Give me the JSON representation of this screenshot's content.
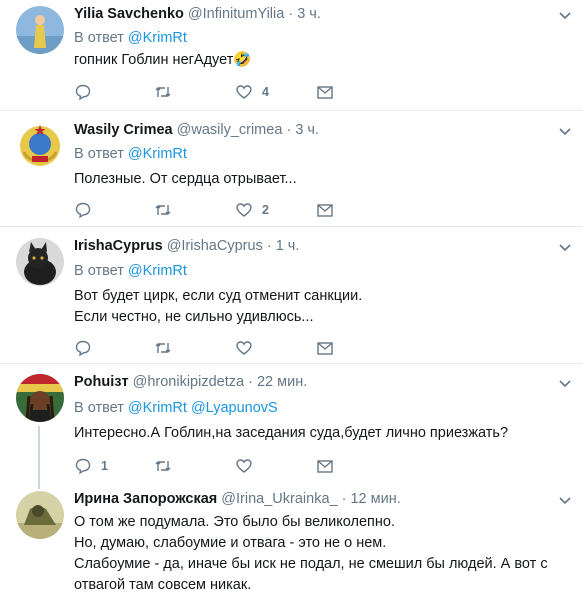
{
  "tweets": [
    {
      "name": "Yilia Savchenko",
      "handle": "@InfinitumYilia",
      "separator": "·",
      "time": "3 ч.",
      "reply_prefix": "В ответ",
      "reply_to": [
        "@KrimRt"
      ],
      "lines": [
        "гопник Гоблин негАдует🤣"
      ],
      "reply_count": "",
      "retweet_count": "",
      "like_count": "4",
      "avatar_icon": "woman-avatar",
      "colors": {
        "avatar_bg": "#8fb8de"
      }
    },
    {
      "name": "Wasily Crimea",
      "handle": "@wasily_crimea",
      "separator": "·",
      "time": "3 ч.",
      "reply_prefix": "В ответ",
      "reply_to": [
        "@KrimRt"
      ],
      "lines": [
        "Полезные. От сердца отрывает..."
      ],
      "reply_count": "",
      "retweet_count": "",
      "like_count": "2",
      "avatar_icon": "ussr-emblem-avatar",
      "colors": {
        "avatar_bg": "#ffffff"
      }
    },
    {
      "name": "IrishaCyprus",
      "handle": "@IrishaCyprus",
      "separator": "·",
      "time": "1 ч.",
      "reply_prefix": "В ответ",
      "reply_to": [
        "@KrimRt"
      ],
      "lines": [
        "Вот будет цирк, если суд отменит санкции.",
        "Если честно, не сильно удивлюсь..."
      ],
      "reply_count": "",
      "retweet_count": "",
      "like_count": "",
      "avatar_icon": "cat-avatar",
      "colors": {
        "avatar_bg": "#d9d9d9"
      }
    },
    {
      "name": "Pohuiзт",
      "handle": "@hronikipizdetza",
      "separator": "·",
      "time": "22 мин.",
      "reply_prefix": "В ответ",
      "reply_to": [
        "@KrimRt",
        "@LyapunovS"
      ],
      "lines": [
        "Интересно.А Гоблин,на заседания суда,будет лично приезжать?"
      ],
      "reply_count": "1",
      "retweet_count": "",
      "like_count": "",
      "avatar_icon": "rasta-avatar",
      "colors": {
        "avatar_bg": "#3a6b3a"
      }
    },
    {
      "name": "Ирина Запорожская",
      "handle": "@Irina_Ukrainka_",
      "separator": "·",
      "time": "12 мин.",
      "lines": [
        "О том же подумала. Это было бы великолепно.",
        "Но, думаю, слабоумие и отвага - это не о нем.",
        "Слабоумие - да, иначе бы иск не подал, не смешил бы людей. А вот с",
        "отвагой там совсем никак."
      ],
      "avatar_icon": "sphinx-avatar",
      "colors": {
        "avatar_bg": "#d6d2a8"
      }
    }
  ],
  "colors": {
    "link": "#1b95e0",
    "secondary": "#657786",
    "divider": "#e6ecf0",
    "thread_line": "#ccd6dd"
  }
}
